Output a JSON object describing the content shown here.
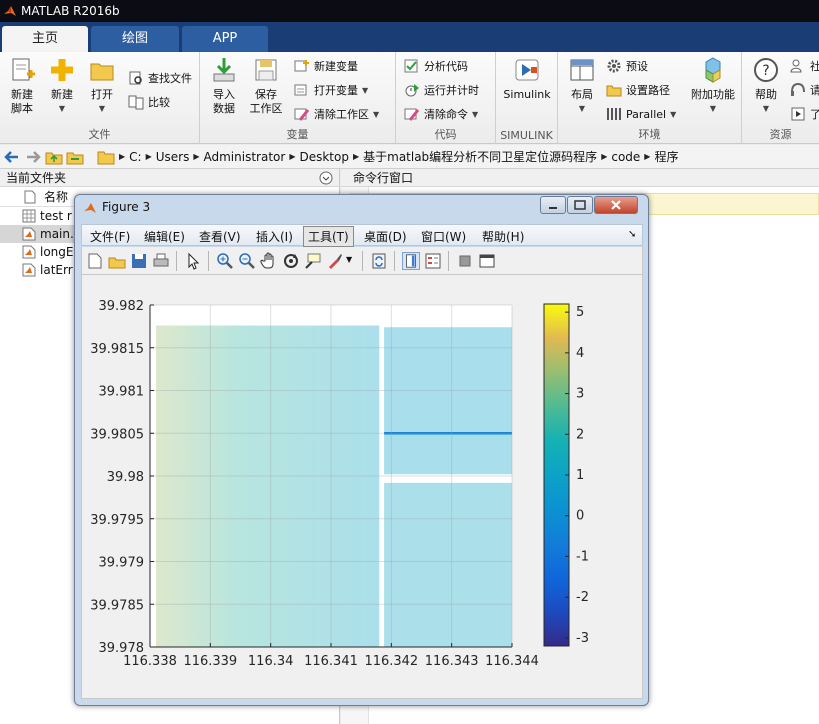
{
  "app": {
    "title": "MATLAB R2016b"
  },
  "tabs": [
    {
      "label": "主页",
      "active": true
    },
    {
      "label": "绘图",
      "active": false
    },
    {
      "label": "APP",
      "active": false
    }
  ],
  "ribbon": {
    "file": {
      "label": "文件",
      "new_script": [
        "新建",
        "脚本"
      ],
      "new": "新建",
      "open": "打开",
      "find_files": "查找文件",
      "compare": "比较"
    },
    "variable": {
      "label": "变量",
      "import": [
        "导入",
        "数据"
      ],
      "save_ws": [
        "保存",
        "工作区"
      ],
      "new_var": "新建变量",
      "open_var": "打开变量",
      "clear_ws": "清除工作区"
    },
    "code": {
      "label": "代码",
      "analyze": "分析代码",
      "run_time": "运行并计时",
      "clear_cmd": "清除命令"
    },
    "simulink": {
      "label": "SIMULINK",
      "btn": "Simulink"
    },
    "env": {
      "label": "环境",
      "layout": "布局",
      "prefs": "预设",
      "set_path": "设置路径",
      "parallel": "Parallel",
      "addons": "附加功能"
    },
    "resources": {
      "label": "资源",
      "help": "帮助",
      "community": "社",
      "request": "请",
      "learn": "了"
    }
  },
  "address": {
    "path": [
      "C:",
      "Users",
      "Administrator",
      "Desktop",
      "基于matlab编程分析不同卫星定位源码程序",
      "code",
      "程序"
    ]
  },
  "file_panel": {
    "title": "当前文件夹",
    "column": "名称",
    "files": [
      {
        "name": "test r",
        "type": "mat"
      },
      {
        "name": "main.",
        "type": "m",
        "selected": true
      },
      {
        "name": "longE",
        "type": "m"
      },
      {
        "name": "latErr",
        "type": "m"
      }
    ]
  },
  "cmd_panel": {
    "title": "命令行窗口"
  },
  "figure": {
    "title": "Figure 3",
    "menus": [
      "文件(F)",
      "编辑(E)",
      "查看(V)",
      "插入(I)",
      "工具(T)",
      "桌面(D)",
      "窗口(W)",
      "帮助(H)"
    ],
    "active_menu": "工具(T)",
    "toolbar_icons": [
      "new-figure-icon",
      "open-icon",
      "save-icon",
      "print-icon",
      "pointer-icon",
      "zoom-in-icon",
      "zoom-out-icon",
      "pan-icon",
      "rotate-icon",
      "data-cursor-icon",
      "brush-icon",
      "link-plot-icon",
      "colorbar-icon",
      "legend-icon",
      "hide-tools-icon",
      "dock-icon"
    ]
  },
  "chart_data": {
    "type": "heatmap",
    "title": "",
    "xlabel": "",
    "ylabel": "",
    "xlim": [
      116.338,
      116.344
    ],
    "ylim": [
      39.978,
      39.982
    ],
    "x_ticks": [
      "116.338",
      "116.339",
      "116.34",
      "116.341",
      "116.342",
      "116.343",
      "116.344"
    ],
    "y_ticks": [
      "39.982",
      "39.9815",
      "39.981",
      "39.9805",
      "39.98",
      "39.9795",
      "39.979",
      "39.9785",
      "39.978"
    ],
    "colorbar": {
      "colormap": "parula",
      "range": [
        -3.2,
        5.2
      ],
      "ticks": [
        "5",
        "4",
        "3",
        "2",
        "1",
        "0",
        "-1",
        "-2",
        "-3"
      ]
    },
    "blocks": [
      {
        "x": [
          116.3381,
          116.3418
        ],
        "y": [
          39.978,
          39.98176
        ],
        "value_left": 3.6,
        "value_right": 1.0
      },
      {
        "x": [
          116.34188,
          116.344
        ],
        "y": [
          39.98002,
          39.98174
        ],
        "value": 0.8
      },
      {
        "x": [
          116.34188,
          116.344
        ],
        "y": [
          39.978,
          39.97992
        ],
        "value": 1.2
      }
    ],
    "lines": [
      {
        "x": [
          116.34188,
          116.344
        ],
        "y": 39.9805,
        "value": -0.5
      }
    ],
    "grid": true
  }
}
